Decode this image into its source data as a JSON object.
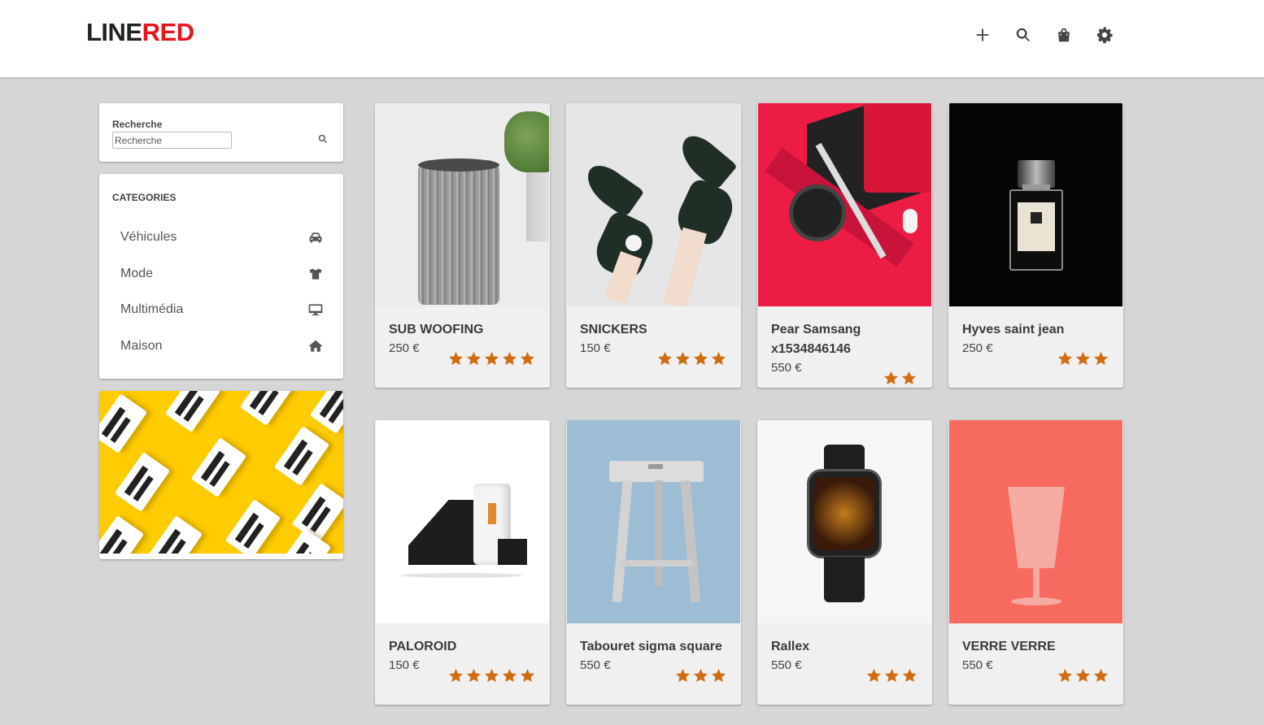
{
  "header": {
    "logo_part1": "LINE",
    "logo_part2": "RED",
    "actions": [
      {
        "name": "add-icon",
        "label": "add"
      },
      {
        "name": "search-icon",
        "label": "search"
      },
      {
        "name": "shopping-bag-icon",
        "label": "cart"
      },
      {
        "name": "gear-icon",
        "label": "settings"
      }
    ]
  },
  "sidebar": {
    "search": {
      "label": "Recherche",
      "placeholder": "Recherche"
    },
    "categories": {
      "title": "CATEGORIES",
      "items": [
        {
          "label": "Véhicules",
          "icon": "car-icon"
        },
        {
          "label": "Mode",
          "icon": "tshirt-icon"
        },
        {
          "label": "Multimédia",
          "icon": "desktop-icon"
        },
        {
          "label": "Maison",
          "icon": "home-icon"
        }
      ]
    }
  },
  "products": [
    {
      "name": "SUB WOOFING",
      "price": "250 €",
      "rating": 5
    },
    {
      "name": "SNICKERS",
      "price": "150 €",
      "rating": 4
    },
    {
      "name": "Pear Samsang x1534846146",
      "price": "550 €",
      "rating": 2
    },
    {
      "name": "Hyves saint jean",
      "price": "250 €",
      "rating": 3
    },
    {
      "name": "PALOROID",
      "price": "150 €",
      "rating": 5
    },
    {
      "name": "Tabouret sigma square",
      "price": "550 €",
      "rating": 3
    },
    {
      "name": "Rallex",
      "price": "550 €",
      "rating": 3
    },
    {
      "name": "VERRE VERRE",
      "price": "550 €",
      "rating": 3
    }
  ],
  "colors": {
    "accent": "#e8141c",
    "star": "#cf6d15",
    "background": "#d6d6d6"
  }
}
